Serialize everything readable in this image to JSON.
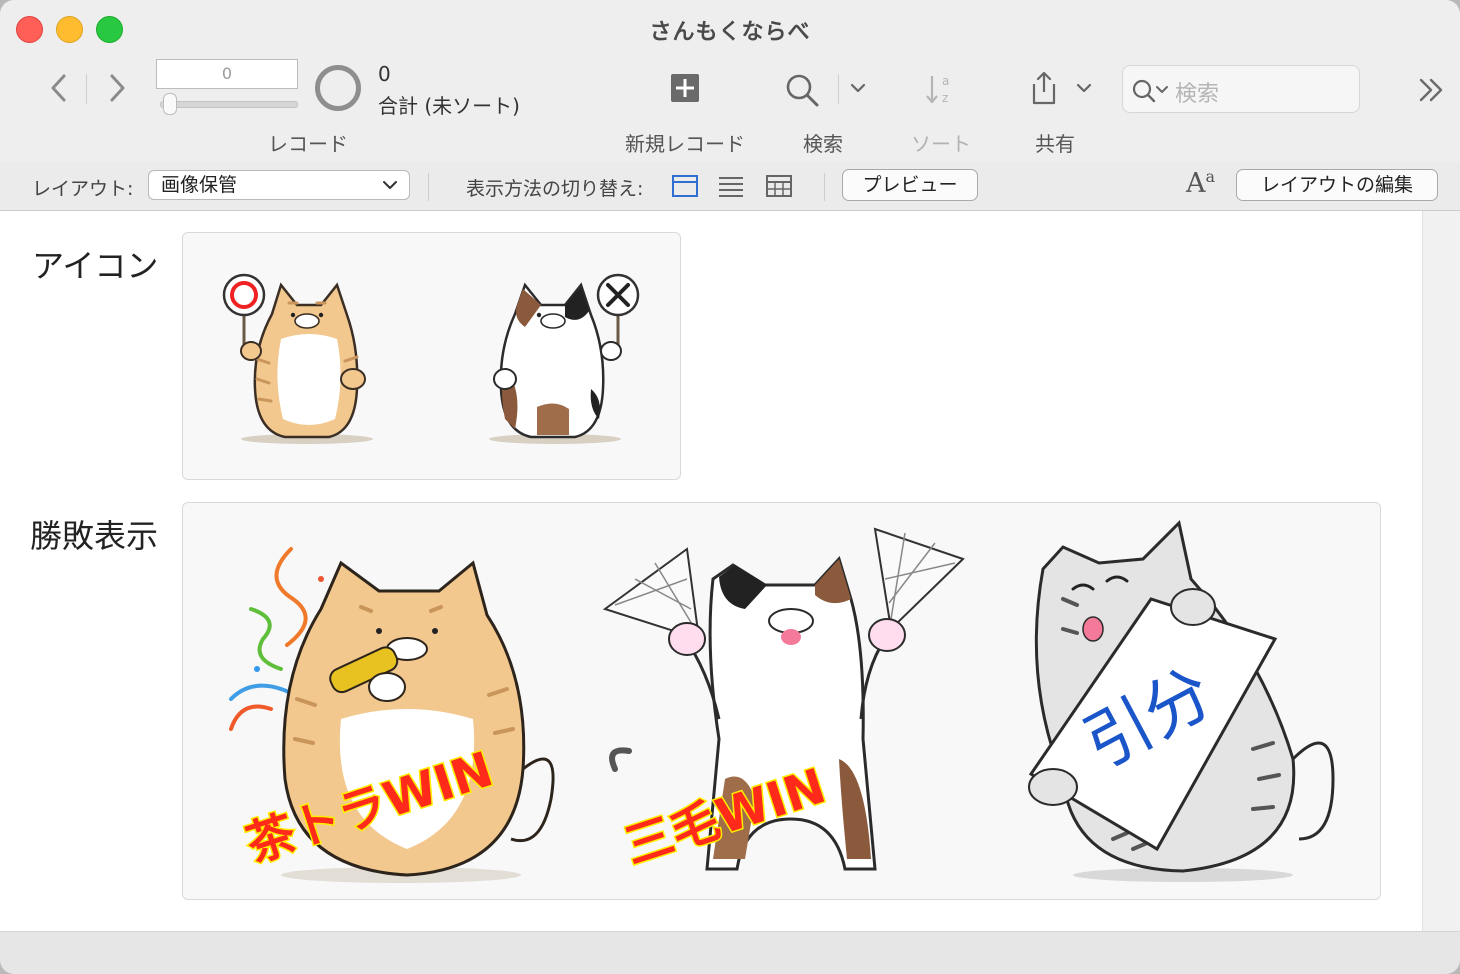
{
  "window": {
    "title": "さんもくならべ"
  },
  "records": {
    "current": "0",
    "found_count": "0",
    "found_label": "合計 (未ソート)",
    "group_label": "レコード"
  },
  "toolbar": {
    "new_record": "新規レコード",
    "find": "検索",
    "sort": "ソート",
    "share": "共有",
    "search_placeholder": "検索"
  },
  "layout_bar": {
    "layout_label": "レイアウト:",
    "layout_value": "画像保管",
    "view_as_label": "表示方法の切り替え:",
    "preview": "プレビュー",
    "edit_layout": "レイアウトの編集"
  },
  "fields": {
    "icon_label": "アイコン",
    "result_label": "勝敗表示"
  },
  "images": {
    "icons": [
      {
        "name": "tabby-cat-circle-sign",
        "sign": "〇"
      },
      {
        "name": "calico-cat-cross-sign",
        "sign": "×"
      }
    ],
    "results": [
      {
        "name": "tabby-cat-party-popper",
        "caption": "茶トラWIN"
      },
      {
        "name": "calico-cat-fans",
        "caption": "三毛WIN"
      },
      {
        "name": "gray-tabby-cat-banner",
        "caption": "引分"
      }
    ]
  },
  "colors": {
    "caption_fill": "#ff2a1a",
    "caption_glow": "#ffee00",
    "draw_text": "#1a56c9",
    "tabby": "#f2c88e",
    "tabby_stripe": "#c9955a",
    "calico_brown": "#8b5a3c",
    "gray_tabby": "#d2d2d2"
  }
}
